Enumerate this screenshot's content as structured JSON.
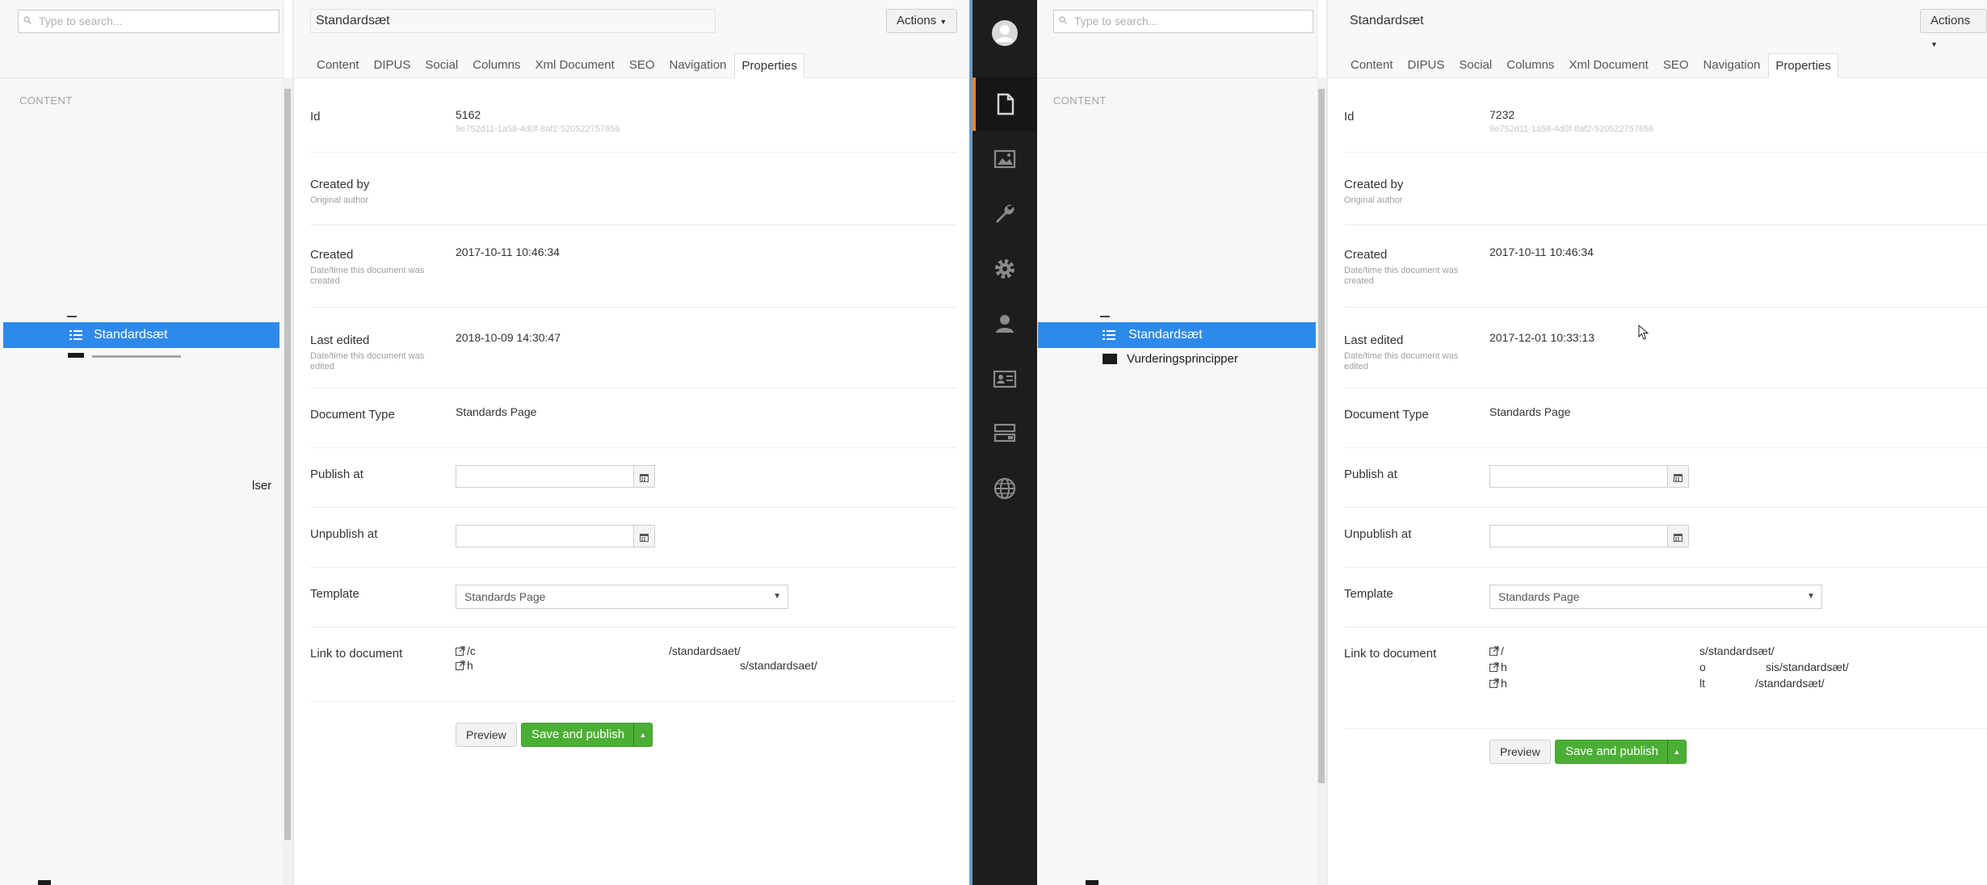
{
  "left_pane": {
    "tree": {
      "search_placeholder": "Type to search...",
      "section_label": "CONTENT",
      "selected_item": "Standardsæt",
      "stray_text": "lser"
    },
    "editor": {
      "name_value": "Standardsæt",
      "actions_label": "Actions",
      "tabs": [
        "Content",
        "DIPUS",
        "Social",
        "Columns",
        "Xml Document",
        "SEO",
        "Navigation",
        "Properties"
      ],
      "active_tab": "Properties",
      "props": {
        "id_label": "Id",
        "id_value": "5162",
        "guid": "9e752d11-1a58-4d0f-8af2-520522757656",
        "created_by_label": "Created by",
        "created_by_desc": "Original author",
        "created_label": "Created",
        "created_desc": "Date/time this document was created",
        "created_value": "2017-10-11 10:46:34",
        "last_edited_label": "Last edited",
        "last_edited_desc": "Date/time this document was edited",
        "last_edited_value": "2018-10-09 14:30:47",
        "doctype_label": "Document Type",
        "doctype_value": "Standards Page",
        "publish_at_label": "Publish at",
        "unpublish_at_label": "Unpublish at",
        "template_label": "Template",
        "template_value": "Standards Page",
        "link_label": "Link to document",
        "links": [
          {
            "a": "/c",
            "b": "/standardsaet/"
          },
          {
            "a": "h",
            "b": "s/standardsaet/"
          }
        ]
      },
      "preview_label": "Preview",
      "publish_label": "Save and publish"
    }
  },
  "right_pane": {
    "tree": {
      "search_placeholder": "Type to search...",
      "section_label": "CONTENT",
      "selected_item": "Standardsæt",
      "second_item": "Vurderingsprincipper"
    },
    "editor": {
      "name_value": "Standardsæt",
      "actions_label": "Actions",
      "tabs": [
        "Content",
        "DIPUS",
        "Social",
        "Columns",
        "Xml Document",
        "SEO",
        "Navigation",
        "Properties"
      ],
      "active_tab": "Properties",
      "props": {
        "id_label": "Id",
        "id_value": "7232",
        "guid": "9e752d11-1a58-4d0f-8af2-520522757656",
        "created_by_label": "Created by",
        "created_by_desc": "Original author",
        "created_label": "Created",
        "created_desc": "Date/time this document was created",
        "created_value": "2017-10-11 10:46:34",
        "last_edited_label": "Last edited",
        "last_edited_desc": "Date/time this document was edited",
        "last_edited_value": "2017-12-01 10:33:13",
        "doctype_label": "Document Type",
        "doctype_value": "Standards Page",
        "publish_at_label": "Publish at",
        "unpublish_at_label": "Unpublish at",
        "template_label": "Template",
        "template_value": "Standards Page",
        "link_label": "Link to document",
        "links": [
          {
            "a": "/",
            "b": "s/standardsæt/"
          },
          {
            "a": "h",
            "m": "o",
            "b": "sis/standardsæt/"
          },
          {
            "a": "h",
            "m": "lt",
            "b": "/standardsæt/"
          }
        ]
      },
      "preview_label": "Preview",
      "publish_label": "Save and publish"
    }
  },
  "app_sidebar": {
    "icons": [
      "avatar-icon",
      "content-icon",
      "media-icon",
      "settings-wrench-icon",
      "developer-gear-icon",
      "users-icon",
      "members-icon",
      "forms-icon",
      "translation-globe-icon"
    ],
    "accent_color": "#f5822a"
  },
  "colors": {
    "selection": "#2e8aea",
    "publish": "#4caf35",
    "sidebar": "#1d1d1d"
  }
}
